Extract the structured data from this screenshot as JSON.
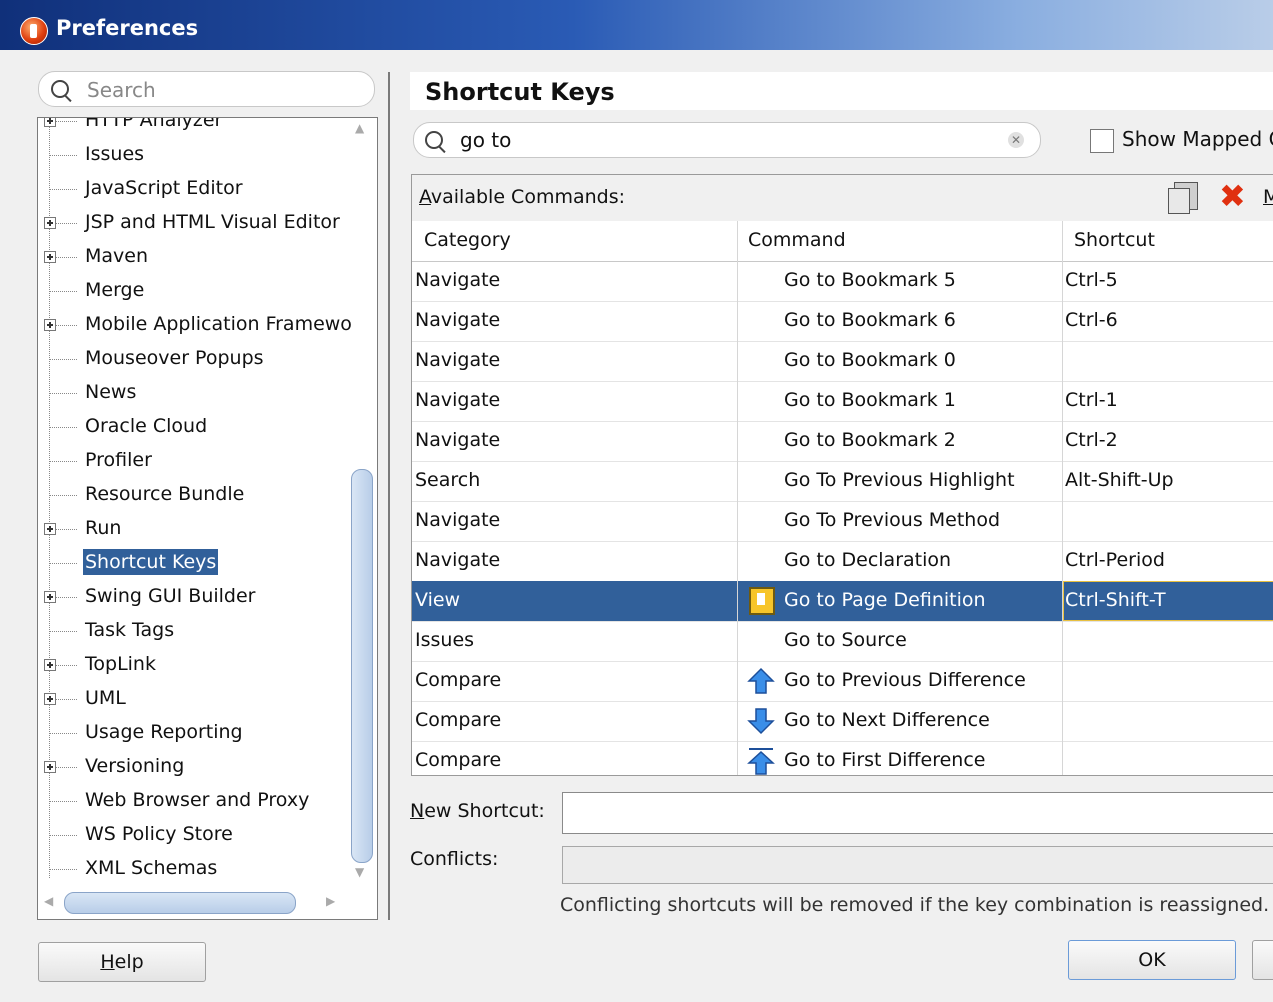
{
  "window": {
    "title": "Preferences"
  },
  "left": {
    "search_placeholder": "Search",
    "tree": [
      {
        "label": "HTTP Analyzer",
        "expandable": true
      },
      {
        "label": "Issues",
        "expandable": false
      },
      {
        "label": "JavaScript Editor",
        "expandable": false
      },
      {
        "label": "JSP and HTML Visual Editor",
        "expandable": true
      },
      {
        "label": "Maven",
        "expandable": true
      },
      {
        "label": "Merge",
        "expandable": false
      },
      {
        "label": "Mobile Application Framewo",
        "expandable": true
      },
      {
        "label": "Mouseover Popups",
        "expandable": false
      },
      {
        "label": "News",
        "expandable": false
      },
      {
        "label": "Oracle Cloud",
        "expandable": false
      },
      {
        "label": "Profiler",
        "expandable": false
      },
      {
        "label": "Resource Bundle",
        "expandable": false
      },
      {
        "label": "Run",
        "expandable": true
      },
      {
        "label": "Shortcut Keys",
        "expandable": false,
        "selected": true
      },
      {
        "label": "Swing GUI Builder",
        "expandable": true
      },
      {
        "label": "Task Tags",
        "expandable": false
      },
      {
        "label": "TopLink",
        "expandable": true
      },
      {
        "label": "UML",
        "expandable": true
      },
      {
        "label": "Usage Reporting",
        "expandable": false
      },
      {
        "label": "Versioning",
        "expandable": true
      },
      {
        "label": "Web Browser and Proxy",
        "expandable": false
      },
      {
        "label": "WS Policy Store",
        "expandable": false
      },
      {
        "label": "XML Schemas",
        "expandable": false
      }
    ]
  },
  "right": {
    "title": "Shortcut Keys",
    "search_value": "go to",
    "show_mapped_label": "Show Mapped C",
    "available_commands": {
      "prefix": "A",
      "rest": "vailable Commands:"
    },
    "toolbar_more": "M",
    "columns": [
      "Category",
      "Command",
      "Shortcut"
    ],
    "rows": [
      {
        "category": "Navigate",
        "command": "Go to Bookmark 5",
        "shortcut": "Ctrl-5",
        "icon": ""
      },
      {
        "category": "Navigate",
        "command": "Go to Bookmark 6",
        "shortcut": "Ctrl-6",
        "icon": ""
      },
      {
        "category": "Navigate",
        "command": "Go to Bookmark 0",
        "shortcut": "",
        "icon": ""
      },
      {
        "category": "Navigate",
        "command": "Go to Bookmark 1",
        "shortcut": "Ctrl-1",
        "icon": ""
      },
      {
        "category": "Navigate",
        "command": "Go to Bookmark 2",
        "shortcut": "Ctrl-2",
        "icon": ""
      },
      {
        "category": "Search",
        "command": "Go To Previous Highlight",
        "shortcut": "Alt-Shift-Up",
        "icon": ""
      },
      {
        "category": "Navigate",
        "command": "Go To Previous Method",
        "shortcut": "",
        "icon": ""
      },
      {
        "category": "Navigate",
        "command": "Go to Declaration",
        "shortcut": "Ctrl-Period",
        "icon": ""
      },
      {
        "category": "View",
        "command": "Go to Page Definition",
        "shortcut": "Ctrl-Shift-T",
        "icon": "page-definition-icon",
        "selected": true
      },
      {
        "category": "Issues",
        "command": "Go to Source",
        "shortcut": "",
        "icon": ""
      },
      {
        "category": "Compare",
        "command": "Go to Previous Difference",
        "shortcut": "",
        "icon": "arrow-up-icon"
      },
      {
        "category": "Compare",
        "command": "Go to Next Difference",
        "shortcut": "",
        "icon": "arrow-down-icon"
      },
      {
        "category": "Compare",
        "command": "Go to First Difference",
        "shortcut": "",
        "icon": "arrow-first-icon"
      }
    ],
    "new_shortcut": {
      "prefix": "N",
      "rest": "ew Shortcut:",
      "value": ""
    },
    "conflicts_label": "Conflicts:",
    "conflict_note": "Conflicting shortcuts will be removed if the key combination is reassigned."
  },
  "buttons": {
    "help": {
      "prefix": "H",
      "rest": "elp"
    },
    "ok": "OK"
  },
  "colors": {
    "selection": "#31609a",
    "title_gradient_start": "#10307a",
    "delete_icon": "#e03010"
  }
}
